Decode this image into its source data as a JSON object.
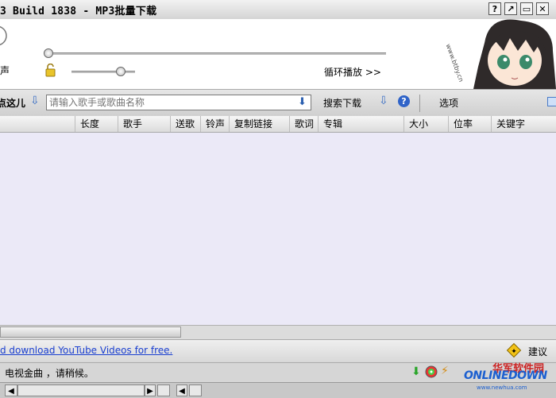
{
  "window": {
    "title": "3 Build 1838 - MP3批量下载",
    "help_btn": "?",
    "restore_btn": "↗",
    "max_btn": "▭",
    "close_btn": "✕"
  },
  "player": {
    "volume_label": "声",
    "loop_label": "循环播放 >>",
    "site_watermark": "www.btby.cn"
  },
  "search": {
    "left_label": "点这儿",
    "placeholder": "请输入歌手或歌曲名称",
    "download_label": "搜索下载",
    "options_label": "选项"
  },
  "table": {
    "columns": [
      "长度",
      "歌手",
      "送歌",
      "铃声",
      "复制链接",
      "歌词",
      "专辑",
      "大小",
      "位率",
      "关键字"
    ]
  },
  "link_bar": {
    "link_text": "d download YouTube Videos for free.",
    "suggest_label": "建议"
  },
  "status": {
    "message": "电视金曲 ，请稍候。",
    "logo_text": "ONLINEDOWN",
    "logo_cn": "华军软件园",
    "logo_sub": "www.newhua.com"
  },
  "colors": {
    "list_bg": "#ebe9f7",
    "link": "#1a3fd0"
  }
}
